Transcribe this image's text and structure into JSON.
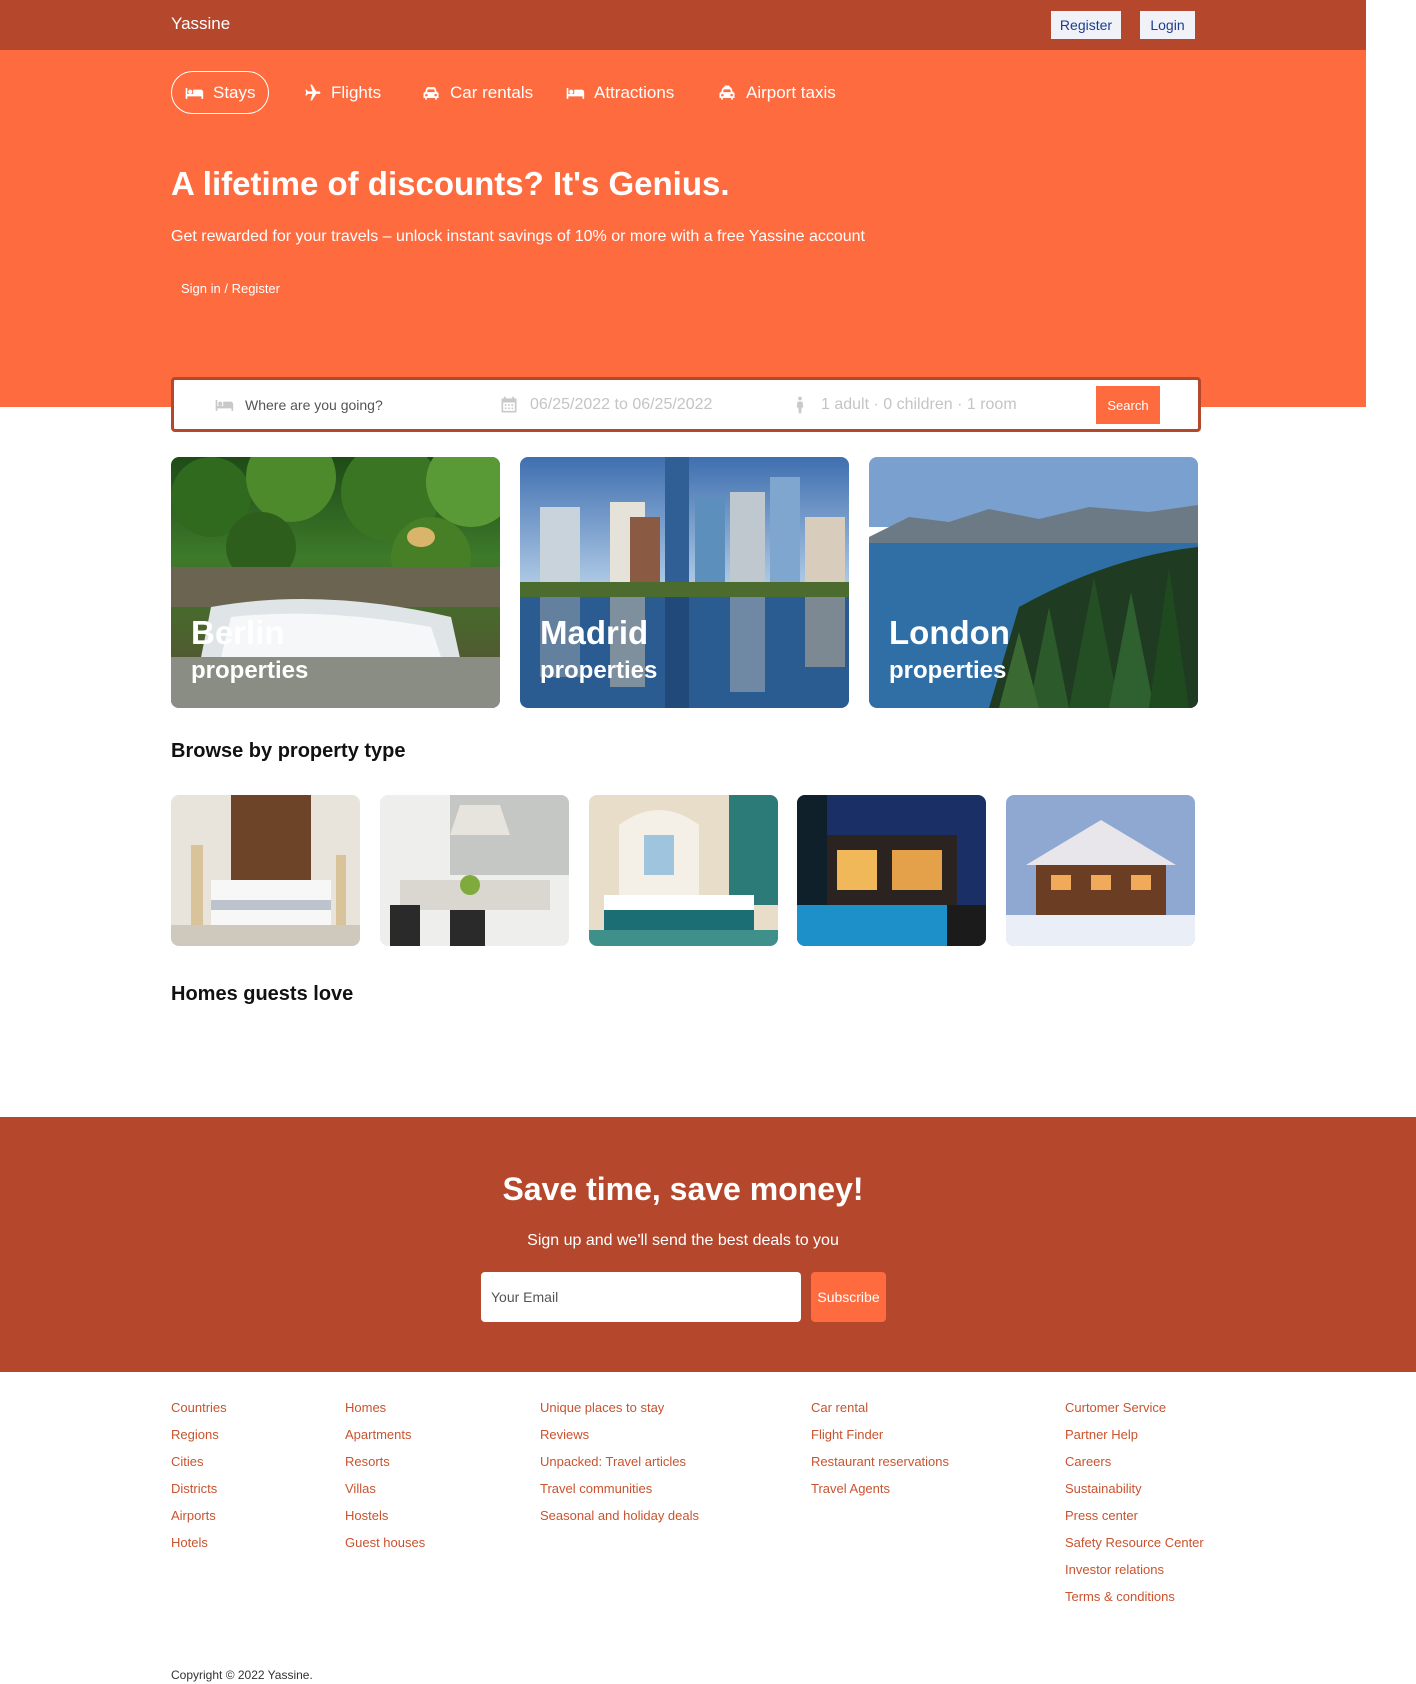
{
  "header": {
    "brand": "Yassine",
    "register_label": "Register",
    "login_label": "Login"
  },
  "tabs": [
    {
      "label": "Stays",
      "icon": "bed-icon",
      "active": true
    },
    {
      "label": "Flights",
      "icon": "plane-icon",
      "active": false
    },
    {
      "label": "Car rentals",
      "icon": "car-icon",
      "active": false
    },
    {
      "label": "Attractions",
      "icon": "bed-icon",
      "active": false
    },
    {
      "label": "Airport taxis",
      "icon": "taxi-icon",
      "active": false
    }
  ],
  "hero": {
    "title": "A lifetime of discounts? It's Genius.",
    "subtitle": "Get rewarded for your travels – unlock instant savings of 10% or more with a free Yassine account",
    "signin_label": "Sign in / Register"
  },
  "search": {
    "destination_placeholder": "Where are you going?",
    "dates": "06/25/2022 to 06/25/2022",
    "guests": "1 adult · 0 children · 1 room",
    "button_label": "Search"
  },
  "cities": [
    {
      "name": "Berlin",
      "subtitle": "properties"
    },
    {
      "name": "Madrid",
      "subtitle": "properties"
    },
    {
      "name": "London",
      "subtitle": "properties"
    }
  ],
  "sections": {
    "browse_title": "Browse by property type",
    "homes_title": "Homes guests love"
  },
  "newsletter": {
    "title": "Save time, save money!",
    "subtitle": "Sign up and we'll send the best deals to you",
    "email_placeholder": "Your Email",
    "button_label": "Subscribe"
  },
  "footer": {
    "columns": [
      [
        "Countries",
        "Regions",
        "Cities",
        "Districts",
        "Airports",
        "Hotels"
      ],
      [
        "Homes",
        "Apartments",
        "Resorts",
        "Villas",
        "Hostels",
        "Guest houses"
      ],
      [
        "Unique places to stay",
        "Reviews",
        "Unpacked: Travel articles",
        "Travel communities",
        "Seasonal and holiday deals"
      ],
      [
        "Car rental",
        "Flight Finder",
        "Restaurant reservations",
        "Travel Agents"
      ],
      [
        "Curtomer Service",
        "Partner Help",
        "Careers",
        "Sustainability",
        "Press center",
        "Safety Resource Center",
        "Investor relations",
        "Terms & conditions"
      ]
    ],
    "copyright": "Copyright © 2022 Yassine."
  },
  "colors": {
    "primary": "#fe6b3f",
    "dark": "#b5472c",
    "link": "#c9532f"
  }
}
